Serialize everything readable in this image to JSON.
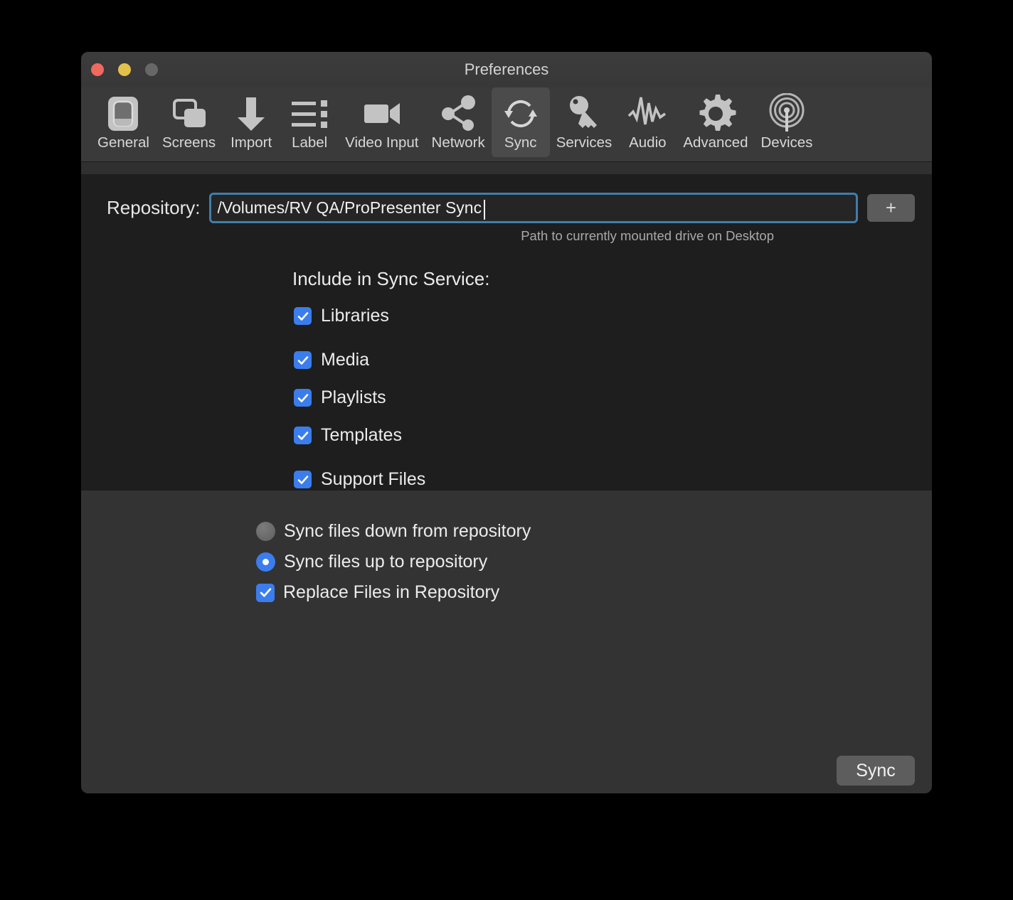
{
  "window": {
    "title": "Preferences",
    "traffic_lights": [
      {
        "name": "close",
        "color": "#ee6a5f"
      },
      {
        "name": "minimize",
        "color": "#e4c14a"
      },
      {
        "name": "zoom",
        "color": "#676767"
      }
    ]
  },
  "toolbar": {
    "selected": "Sync",
    "items": [
      {
        "label": "General",
        "icon": "general-switch-icon"
      },
      {
        "label": "Screens",
        "icon": "screens-icon"
      },
      {
        "label": "Import",
        "icon": "import-down-arrow-icon"
      },
      {
        "label": "Label",
        "icon": "label-list-icon"
      },
      {
        "label": "Video Input",
        "icon": "video-camera-icon"
      },
      {
        "label": "Network",
        "icon": "network-share-icon"
      },
      {
        "label": "Sync",
        "icon": "sync-circular-arrows-icon"
      },
      {
        "label": "Services",
        "icon": "services-key-icon"
      },
      {
        "label": "Audio",
        "icon": "audio-waveform-icon"
      },
      {
        "label": "Advanced",
        "icon": "advanced-gear-icon"
      },
      {
        "label": "Devices",
        "icon": "devices-antenna-icon"
      }
    ]
  },
  "repository": {
    "label": "Repository:",
    "value": "/Volumes/RV QA/ProPresenter Sync",
    "placeholder": "",
    "hint": "Path to currently mounted drive on Desktop",
    "add_button_label": "+",
    "focus_color": "#3f7fab"
  },
  "include_section": {
    "title": "Include in Sync Service:",
    "accent_color": "#3b7ded",
    "options": [
      {
        "label": "Libraries",
        "checked": true
      },
      {
        "label": "Media",
        "checked": true
      },
      {
        "label": "Playlists",
        "checked": true
      },
      {
        "label": "Templates",
        "checked": true
      },
      {
        "label": "Support Files",
        "checked": true
      }
    ]
  },
  "direction_section": {
    "options": [
      {
        "label": "Sync files down from repository",
        "selected": false
      },
      {
        "label": "Sync files up to repository",
        "selected": true
      }
    ],
    "replace": {
      "label": "Replace Files in Repository",
      "checked": true
    }
  },
  "actions": {
    "sync_button_label": "Sync"
  }
}
